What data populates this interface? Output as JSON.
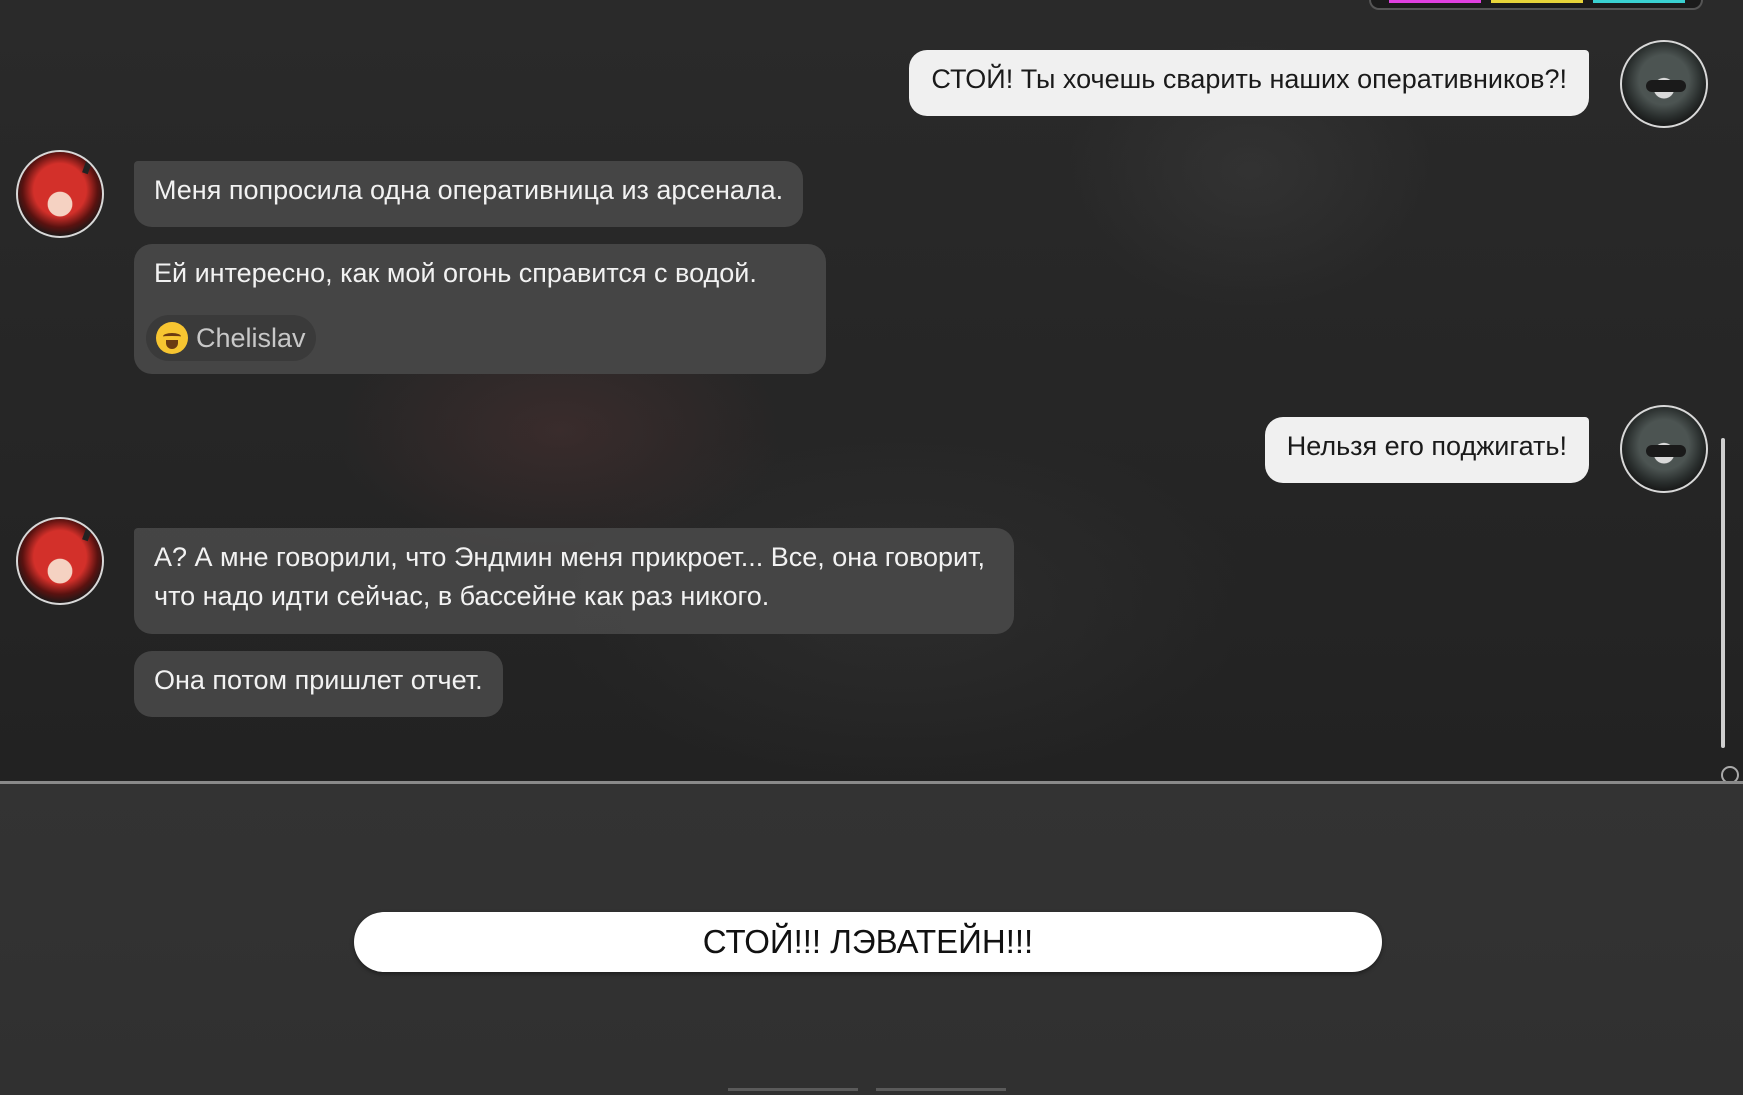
{
  "messages": [
    {
      "side": "right",
      "text": "СТОЙ! Ты хочешь сварить наших оперативников?!"
    },
    {
      "side": "left",
      "text": "Меня попросила одна оперативница из арсенала."
    },
    {
      "side": "left",
      "text": "Ей интересно, как мой огонь справится с водой."
    },
    {
      "side": "right",
      "text": "Нельзя его поджигать!"
    },
    {
      "side": "left",
      "text": "А? А мне говорили, что Эндмин меня прикроет... Все, она говорит, что надо идти сейчас, в бассейне как раз никого."
    },
    {
      "side": "left",
      "text": "Она потом пришлет отчет."
    }
  ],
  "reaction": {
    "emoji_icon": "crying-laughing-emoji-icon",
    "name": "Chelislav"
  },
  "reply": {
    "label": "СТОЙ!!! ЛЭВАТЕЙН!!!"
  },
  "colors": {
    "strip_magenta": "#e040e0",
    "strip_yellow": "#e8d53a",
    "strip_cyan": "#3ad1d1"
  }
}
